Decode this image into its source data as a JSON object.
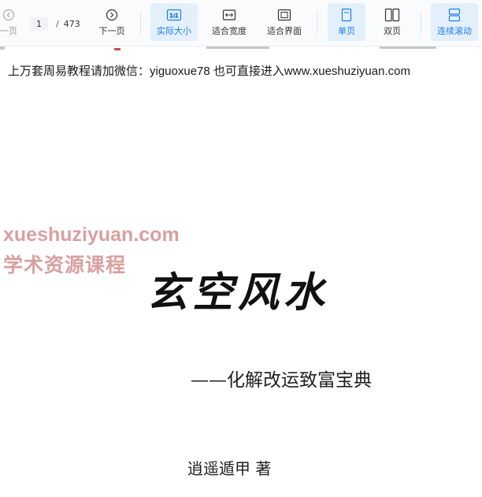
{
  "toolbar": {
    "prev_label": "一页",
    "page": {
      "current": "1",
      "separator": "/",
      "total": "473"
    },
    "next_label": "下一页",
    "actual_size_label": "实际大小",
    "actual_size_icon_text": "1:1",
    "fit_width_label": "适合宽度",
    "fit_page_label": "适合界面",
    "single_page_label": "单页",
    "double_page_label": "双页",
    "continuous_label": "连续滚动"
  },
  "document": {
    "notice": "上万套周易教程请加微信：yiguoxue78  也可直接进入www.xueshuziyuan.com",
    "watermark_line1": "xueshuziyuan.com",
    "watermark_line2": "学术资源课程",
    "title": "玄空风水",
    "subtitle": "——化解改运致富宝典",
    "author": "逍遥遁甲  著"
  },
  "colors": {
    "accent": "#1f7ee6",
    "active_bg": "#e3f0fc",
    "watermark": "#d9a0a0"
  }
}
